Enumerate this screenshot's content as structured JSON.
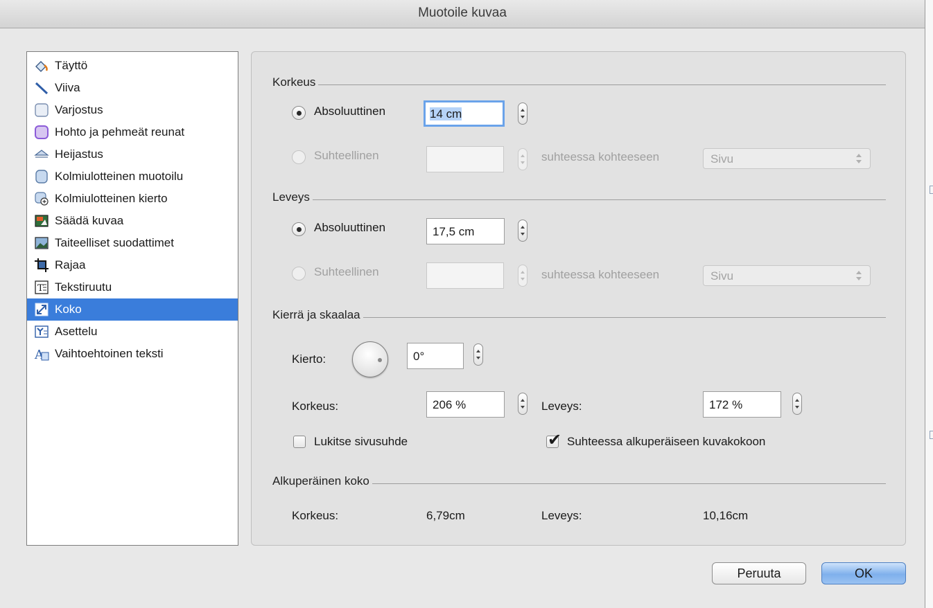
{
  "window": {
    "title": "Muotoile kuvaa"
  },
  "sidebar": {
    "items": [
      {
        "label": "Täyttö",
        "icon": "paint-bucket-icon"
      },
      {
        "label": "Viiva",
        "icon": "line-icon"
      },
      {
        "label": "Varjostus",
        "icon": "shadow-icon"
      },
      {
        "label": "Hohto ja pehmeät reunat",
        "icon": "glow-icon"
      },
      {
        "label": "Heijastus",
        "icon": "reflection-icon"
      },
      {
        "label": "Kolmiulotteinen muotoilu",
        "icon": "3d-format-icon"
      },
      {
        "label": "Kolmiulotteinen kierto",
        "icon": "3d-rotation-icon"
      },
      {
        "label": "Säädä kuvaa",
        "icon": "adjust-picture-icon"
      },
      {
        "label": "Taiteelliset suodattimet",
        "icon": "artistic-filters-icon"
      },
      {
        "label": "Rajaa",
        "icon": "crop-icon"
      },
      {
        "label": "Tekstiruutu",
        "icon": "text-box-icon"
      },
      {
        "label": "Koko",
        "icon": "size-icon",
        "selected": true
      },
      {
        "label": "Asettelu",
        "icon": "layout-icon"
      },
      {
        "label": "Vaihtoehtoinen teksti",
        "icon": "alt-text-icon"
      }
    ]
  },
  "height": {
    "section": "Korkeus",
    "absolute_label": "Absoluuttinen",
    "absolute_value": "14 cm",
    "absolute_selected": true,
    "relative_label": "Suhteellinen",
    "relative_value": "",
    "relative_to_label": "suhteessa kohteeseen",
    "relative_to_value": "Sivu"
  },
  "width": {
    "section": "Leveys",
    "absolute_label": "Absoluuttinen",
    "absolute_value": "17,5 cm",
    "absolute_selected": true,
    "relative_label": "Suhteellinen",
    "relative_value": "",
    "relative_to_label": "suhteessa kohteeseen",
    "relative_to_value": "Sivu"
  },
  "rotate_scale": {
    "section": "Kierrä ja skaalaa",
    "rotation_label": "Kierto:",
    "rotation_value": "0°",
    "scale_height_label": "Korkeus:",
    "scale_height_value": "206 %",
    "scale_width_label": "Leveys:",
    "scale_width_value": "172 %",
    "lock_aspect_label": "Lukitse sivusuhde",
    "lock_aspect_checked": false,
    "relative_original_label": "Suhteessa alkuperäiseen kuvakokoon",
    "relative_original_checked": true
  },
  "original_size": {
    "section": "Alkuperäinen koko",
    "height_label": "Korkeus:",
    "height_value": "6,79cm",
    "width_label": "Leveys:",
    "width_value": "10,16cm"
  },
  "buttons": {
    "cancel": "Peruuta",
    "ok": "OK"
  },
  "colors": {
    "selection": "#3a7ddb",
    "focus_ring": "#6aa3ea",
    "ok_button": "#7fb0ec"
  }
}
